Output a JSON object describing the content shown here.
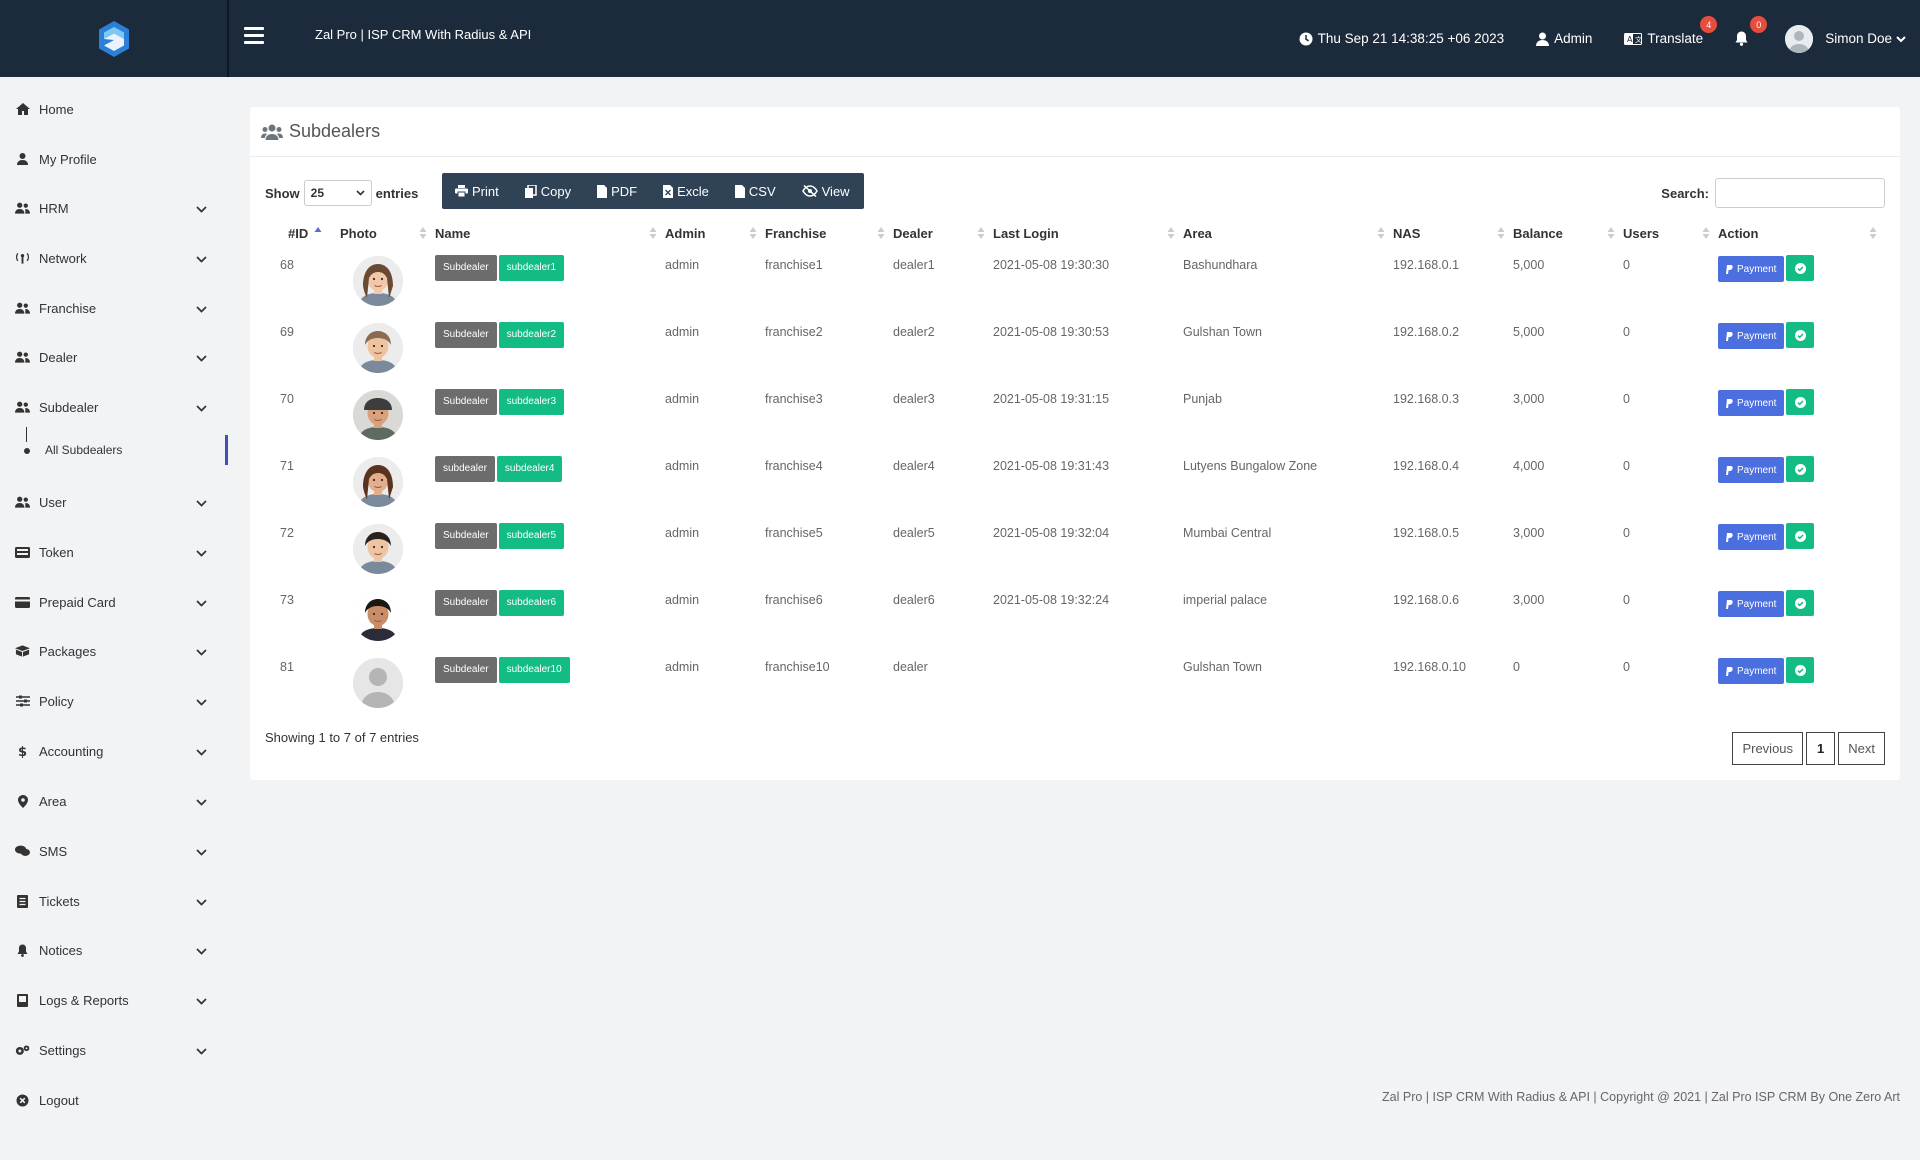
{
  "header": {
    "app_title": "Zal Pro | ISP CRM With Radius & API",
    "datetime": "Thu Sep 21 14:38:25 +06 2023",
    "admin_label": "Admin",
    "translate_label": "Translate",
    "translate_badge": "4",
    "notif_badge": "0",
    "user_name": "Simon Doe"
  },
  "sidebar": {
    "items": [
      {
        "label": "Home",
        "icon": "home-icon"
      },
      {
        "label": "My Profile",
        "icon": "user-icon"
      },
      {
        "label": "HRM",
        "icon": "users-icon"
      },
      {
        "label": "Network",
        "icon": "antenna-icon"
      },
      {
        "label": "Franchise",
        "icon": "users-icon"
      },
      {
        "label": "Dealer",
        "icon": "users-icon"
      },
      {
        "label": "Subdealer",
        "icon": "users-icon"
      },
      {
        "label": "User",
        "icon": "users-icon"
      },
      {
        "label": "Token",
        "icon": "keyboard-icon"
      },
      {
        "label": "Prepaid Card",
        "icon": "card-icon"
      },
      {
        "label": "Packages",
        "icon": "box-icon"
      },
      {
        "label": "Policy",
        "icon": "sliders-icon"
      },
      {
        "label": "Accounting",
        "icon": "dollar-icon"
      },
      {
        "label": "Area",
        "icon": "map-pin-icon"
      },
      {
        "label": "SMS",
        "icon": "chat-icon"
      },
      {
        "label": "Tickets",
        "icon": "ticket-icon"
      },
      {
        "label": "Notices",
        "icon": "bell-icon"
      },
      {
        "label": "Logs & Reports",
        "icon": "book-icon"
      },
      {
        "label": "Settings",
        "icon": "gears-icon"
      },
      {
        "label": "Logout",
        "icon": "logout-icon"
      }
    ],
    "sub_item": "All Subdealers"
  },
  "page": {
    "title": "Subdealers",
    "show_label": "Show",
    "entries_value": "25",
    "entries_label": "entries",
    "search_label": "Search:",
    "buttons": [
      "Print",
      "Copy",
      "PDF",
      "Excle",
      "CSV",
      "View"
    ],
    "info": "Showing 1 to 7 of 7 entries",
    "pager": {
      "prev": "Previous",
      "current": "1",
      "next": "Next"
    }
  },
  "table": {
    "columns": [
      "#ID",
      "Photo",
      "Name",
      "Admin",
      "Franchise",
      "Dealer",
      "Last Login",
      "Area",
      "NAS",
      "Balance",
      "Users",
      "Action"
    ],
    "rows": [
      {
        "id": "68",
        "role": "Subdealer",
        "name": "subdealer1",
        "admin": "admin",
        "franchise": "franchise1",
        "dealer": "dealer1",
        "last_login": "2021-05-08 19:30:30",
        "area": "Bashundhara",
        "nas": "192.168.0.1",
        "balance": "5,000",
        "users": "0",
        "photo": "woman-light"
      },
      {
        "id": "69",
        "role": "Subdealer",
        "name": "subdealer2",
        "admin": "admin",
        "franchise": "franchise2",
        "dealer": "dealer2",
        "last_login": "2021-05-08 19:30:53",
        "area": "Gulshan Town",
        "nas": "192.168.0.2",
        "balance": "5,000",
        "users": "0",
        "photo": "man-light"
      },
      {
        "id": "70",
        "role": "Subdealer",
        "name": "subdealer3",
        "admin": "admin",
        "franchise": "franchise3",
        "dealer": "dealer3",
        "last_login": "2021-05-08 19:31:15",
        "area": "Punjab",
        "nas": "192.168.0.3",
        "balance": "3,000",
        "users": "0",
        "photo": "man-cap"
      },
      {
        "id": "71",
        "role": "subdealer",
        "name": "subdealer4",
        "admin": "admin",
        "franchise": "franchise4",
        "dealer": "dealer4",
        "last_login": "2021-05-08 19:31:43",
        "area": "Lutyens Bungalow Zone",
        "nas": "192.168.0.4",
        "balance": "4,000",
        "users": "0",
        "photo": "woman-brown"
      },
      {
        "id": "72",
        "role": "Subdealer",
        "name": "subdealer5",
        "admin": "admin",
        "franchise": "franchise5",
        "dealer": "dealer5",
        "last_login": "2021-05-08 19:32:04",
        "area": "Mumbai Central",
        "nas": "192.168.0.5",
        "balance": "3,000",
        "users": "0",
        "photo": "man-dark-hair"
      },
      {
        "id": "73",
        "role": "Subdealer",
        "name": "subdealer6",
        "admin": "admin",
        "franchise": "franchise6",
        "dealer": "dealer6",
        "last_login": "2021-05-08 19:32:24",
        "area": "imperial palace",
        "nas": "192.168.0.6",
        "balance": "3,000",
        "users": "0",
        "photo": "man-young"
      },
      {
        "id": "81",
        "role": "Subdealer",
        "name": "subdealer10",
        "admin": "admin",
        "franchise": "franchise10",
        "dealer": "dealer",
        "last_login": "",
        "area": "Gulshan Town",
        "nas": "192.168.0.10",
        "balance": "0",
        "users": "0",
        "photo": "placeholder"
      }
    ],
    "payment_label": "Payment"
  },
  "footer": "Zal Pro | ISP CRM With Radius & API | Copyright @ 2021 | Zal Pro ISP CRM By One Zero Art",
  "colors": {
    "topbar": "#1c2b3c",
    "accent": "#4c6fe0",
    "green": "#12bc84",
    "gray_label": "#6c6c6c",
    "active": "#3f51b5"
  }
}
